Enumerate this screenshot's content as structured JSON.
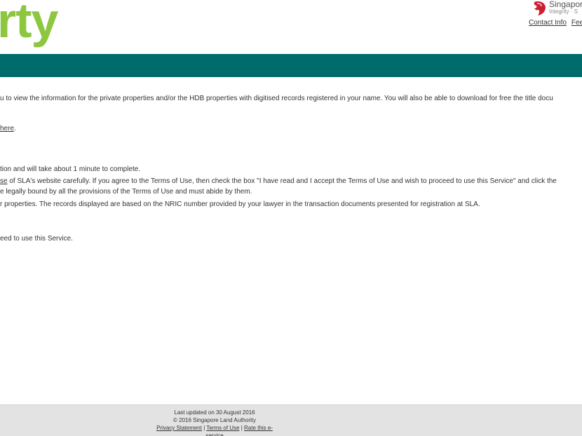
{
  "header": {
    "logo_text": "rty",
    "gov_name": "Singapore",
    "gov_motto": "Integrity · S",
    "links": [
      "Contact Info",
      "Fee"
    ]
  },
  "colors": {
    "brand_green": "#8dc63f",
    "header_bar": "#006b6b",
    "lion_red": "#cc1f2f"
  },
  "content": {
    "intro": "u to view the information for the private properties and/or the HDB properties with digitised records registered in your name. You will also be able to download for free the title docu",
    "here_link": "here",
    "here_suffix": ".",
    "step1": "tion and will take about 1 minute to complete.",
    "step2_link": "se",
    "step2_text": " of SLA's website carefully. If you agree to the Terms of Use, then check the box \"I have read and I accept the Terms of Use and wish to proceed to use this Service\" and click the",
    "step2_cont": "e legally bound by all the provisions of the Terms of Use and must abide by them.",
    "step3": "r properties. The records displayed are based on the NRIC number provided by your lawyer in the transaction documents presented for registration at SLA.",
    "accept_text": "eed to use this Service."
  },
  "footer": {
    "last_updated": "Last updated on 30 August 2016",
    "copyright": "© 2016 Singapore Land Authority",
    "links": [
      "Privacy Statement",
      "Terms of Use",
      "Rate this e-service"
    ],
    "separator": " | "
  }
}
